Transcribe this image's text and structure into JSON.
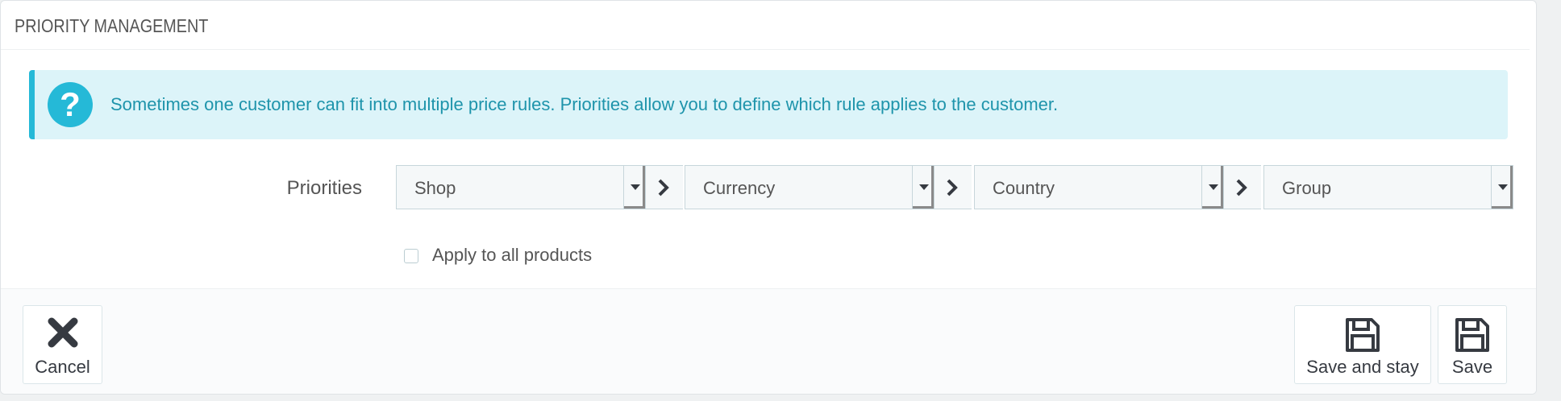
{
  "panel": {
    "title": "PRIORITY MANAGEMENT"
  },
  "alert": {
    "icon": "question-icon",
    "text": "Sometimes one customer can fit into multiple price rules. Priorities allow you to define which rule applies to the customer."
  },
  "priorities": {
    "label": "Priorities",
    "selects": [
      {
        "value": "Shop"
      },
      {
        "value": "Currency"
      },
      {
        "value": "Country"
      },
      {
        "value": "Group"
      }
    ]
  },
  "apply_all": {
    "label": "Apply to all products",
    "checked": false
  },
  "footer": {
    "cancel_label": "Cancel",
    "save_and_stay_label": "Save and stay",
    "save_label": "Save"
  },
  "colors": {
    "accent": "#25b9d7",
    "alert_bg": "#dcf4f9",
    "alert_text": "#1e94ab"
  }
}
